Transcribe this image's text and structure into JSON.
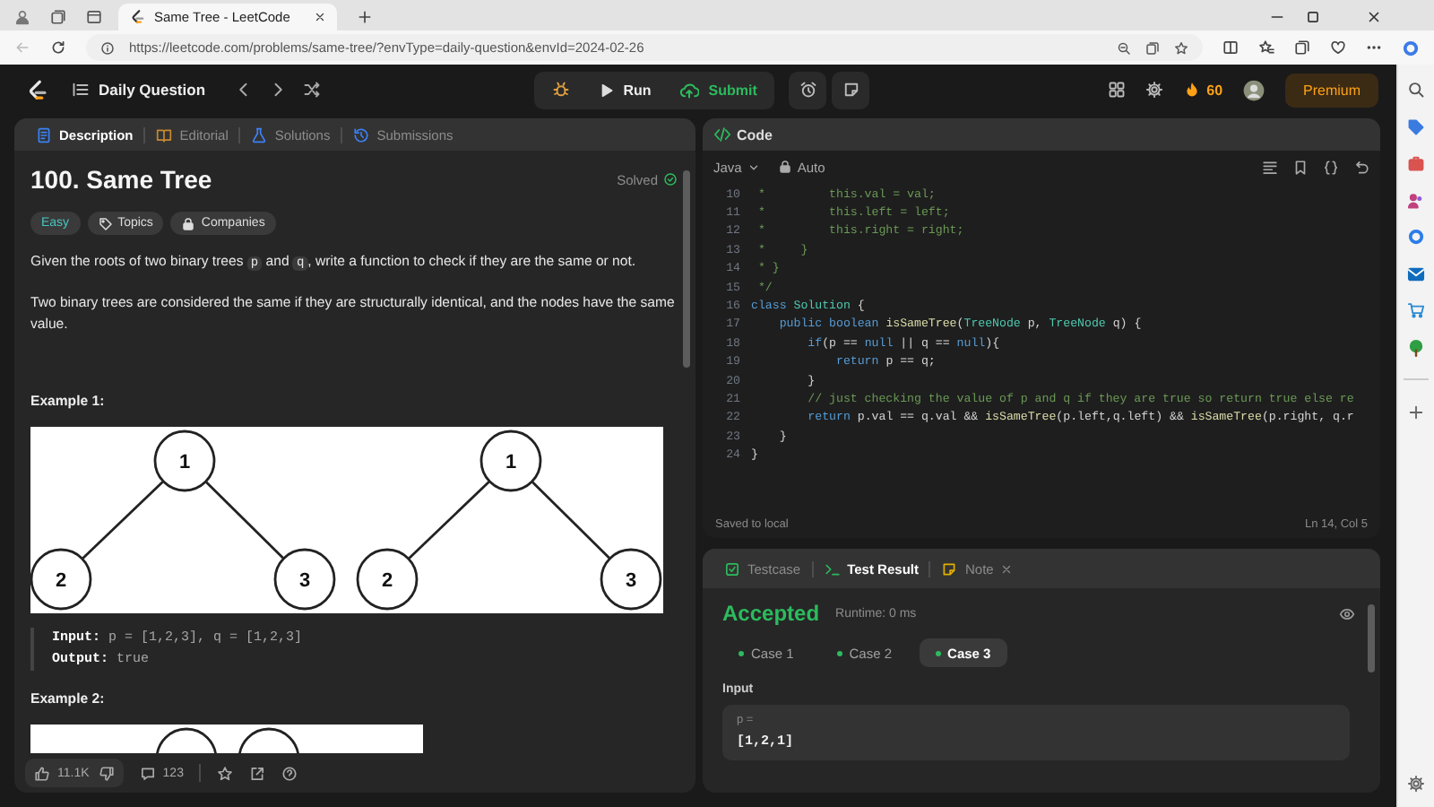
{
  "browser": {
    "tab_title": "Same Tree - LeetCode",
    "url": "https://leetcode.com/problems/same-tree/?envType=daily-question&envId=2024-02-26"
  },
  "nav": {
    "title": "Daily Question",
    "run": "Run",
    "submit": "Submit",
    "streak": "60",
    "premium": "Premium"
  },
  "description": {
    "tabs": [
      {
        "kind": "description",
        "label": "Description",
        "selected": true
      },
      {
        "kind": "editorial",
        "label": "Editorial",
        "selected": false
      },
      {
        "kind": "solutions",
        "label": "Solutions",
        "selected": false
      },
      {
        "kind": "submissions",
        "label": "Submissions",
        "selected": false
      }
    ],
    "title": "100. Same Tree",
    "status": "Solved",
    "difficulty": "Easy",
    "chips": [
      {
        "kind": "topics",
        "label": "Topics"
      },
      {
        "kind": "companies",
        "label": "Companies"
      }
    ],
    "paragraphs": [
      [
        {
          "kind": "text",
          "text": "Given the roots of two binary trees "
        },
        {
          "kind": "code",
          "text": "p"
        },
        {
          "kind": "text",
          "text": " and "
        },
        {
          "kind": "code",
          "text": "q"
        },
        {
          "kind": "text",
          "text": ", write a function to check if they are the same or not."
        }
      ],
      [
        {
          "kind": "text",
          "text": "Two binary trees are considered the same if they are structurally identical, and the nodes have the same value."
        }
      ]
    ],
    "examples": [
      {
        "heading": "Example 1:",
        "trees": [
          [
            "1",
            "2",
            "3"
          ],
          [
            "1",
            "2",
            "3"
          ]
        ],
        "input": "**Input:** p = [1,2,3], q = [1,2,3]",
        "output": "**Output:** true"
      },
      {
        "heading": "Example 2:"
      }
    ],
    "footer": {
      "likes": "11.1K",
      "comments": "123"
    }
  },
  "editor": {
    "title": "Code",
    "language": "Java",
    "mode": "Auto",
    "lines": [
      {
        "number": "10",
        "tokens": [
          {
            "kind": "comment",
            "text": " *         this.val = val;"
          }
        ]
      },
      {
        "number": "11",
        "tokens": [
          {
            "kind": "comment",
            "text": " *         this.left = left;"
          }
        ]
      },
      {
        "number": "12",
        "tokens": [
          {
            "kind": "comment",
            "text": " *         this.right = right;"
          }
        ]
      },
      {
        "number": "13",
        "tokens": [
          {
            "kind": "comment",
            "text": " *     }"
          }
        ]
      },
      {
        "number": "14",
        "tokens": [
          {
            "kind": "comment",
            "text": " * }"
          }
        ]
      },
      {
        "number": "15",
        "tokens": [
          {
            "kind": "comment",
            "text": " */"
          }
        ]
      },
      {
        "number": "16",
        "tokens": [
          {
            "kind": "keyword",
            "text": "class "
          },
          {
            "kind": "type",
            "text": "Solution"
          },
          {
            "kind": "plain",
            "text": " {"
          }
        ]
      },
      {
        "number": "17",
        "tokens": [
          {
            "kind": "keyword",
            "text": "    public boolean "
          },
          {
            "kind": "function",
            "text": "isSameTree"
          },
          {
            "kind": "plain",
            "text": "("
          },
          {
            "kind": "type",
            "text": "TreeNode"
          },
          {
            "kind": "plain",
            "text": " p, "
          },
          {
            "kind": "type",
            "text": "TreeNode"
          },
          {
            "kind": "plain",
            "text": " q) {"
          }
        ]
      },
      {
        "number": "18",
        "tokens": [
          {
            "kind": "keyword",
            "text": "        if"
          },
          {
            "kind": "plain",
            "text": "(p == "
          },
          {
            "kind": "keyword",
            "text": "null"
          },
          {
            "kind": "plain",
            "text": " || q == "
          },
          {
            "kind": "keyword",
            "text": "null"
          },
          {
            "kind": "plain",
            "text": "){"
          }
        ]
      },
      {
        "number": "19",
        "tokens": [
          {
            "kind": "keyword",
            "text": "            return"
          },
          {
            "kind": "plain",
            "text": " p == q;"
          }
        ]
      },
      {
        "number": "20",
        "tokens": [
          {
            "kind": "plain",
            "text": "        }"
          }
        ]
      },
      {
        "number": "21",
        "tokens": [
          {
            "kind": "comment",
            "text": "        // just checking the value of p and q if they are true so return true else re"
          }
        ]
      },
      {
        "number": "22",
        "tokens": [
          {
            "kind": "keyword",
            "text": "        return"
          },
          {
            "kind": "plain",
            "text": " p.val == q.val && "
          },
          {
            "kind": "function",
            "text": "isSameTree"
          },
          {
            "kind": "plain",
            "text": "(p.left,q.left) && "
          },
          {
            "kind": "function",
            "text": "isSameTree"
          },
          {
            "kind": "plain",
            "text": "(p.right, q.r"
          }
        ]
      },
      {
        "number": "23",
        "tokens": [
          {
            "kind": "plain",
            "text": "    }"
          }
        ]
      },
      {
        "number": "24",
        "tokens": [
          {
            "kind": "plain",
            "text": "}"
          }
        ]
      }
    ],
    "status": "Saved to local",
    "cursor": "Ln 14, Col 5"
  },
  "results": {
    "tabs": [
      {
        "kind": "testcase",
        "label": "Testcase",
        "selected": false
      },
      {
        "kind": "result",
        "label": "Test Result",
        "selected": true
      },
      {
        "kind": "note",
        "label": "Note",
        "selected": false
      }
    ],
    "verdict": "Accepted",
    "runtime": "Runtime: 0 ms",
    "cases": [
      {
        "label": "Case 1",
        "selected": false,
        "passed": true
      },
      {
        "label": "Case 2",
        "selected": false,
        "passed": true
      },
      {
        "label": "Case 3",
        "selected": true,
        "passed": true
      }
    ],
    "input_label": "Input",
    "param": "p =",
    "value": "[1,2,1]"
  }
}
